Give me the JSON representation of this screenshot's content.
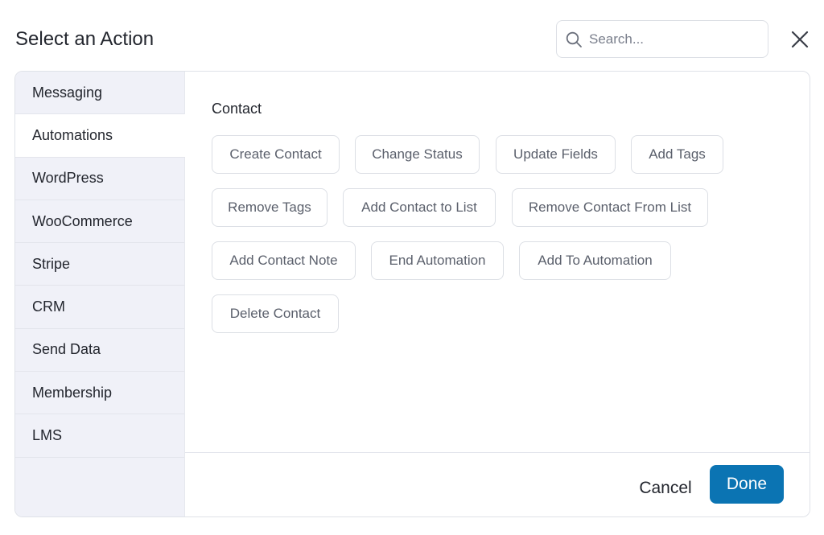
{
  "dialog": {
    "title": "Select an Action",
    "search_placeholder": "Search..."
  },
  "sidebar": {
    "items": [
      {
        "label": "Messaging",
        "active": false
      },
      {
        "label": "Automations",
        "active": true
      },
      {
        "label": "WordPress",
        "active": false
      },
      {
        "label": "WooCommerce",
        "active": false
      },
      {
        "label": "Stripe",
        "active": false
      },
      {
        "label": "CRM",
        "active": false
      },
      {
        "label": "Send Data",
        "active": false
      },
      {
        "label": "Membership",
        "active": false
      },
      {
        "label": "LMS",
        "active": false
      }
    ]
  },
  "content": {
    "section_title": "Contact",
    "actions": [
      "Create Contact",
      "Change Status",
      "Update Fields",
      "Add Tags",
      "Remove Tags",
      "Add Contact to List",
      "Remove Contact From List",
      "Add Contact Note",
      "End Automation",
      "Add To Automation",
      "Delete Contact"
    ]
  },
  "footer": {
    "cancel_label": "Cancel",
    "done_label": "Done"
  },
  "colors": {
    "accent": "#0b74b3",
    "sidebar_bg": "#f0f1f8",
    "chip_text": "#5b606c"
  }
}
